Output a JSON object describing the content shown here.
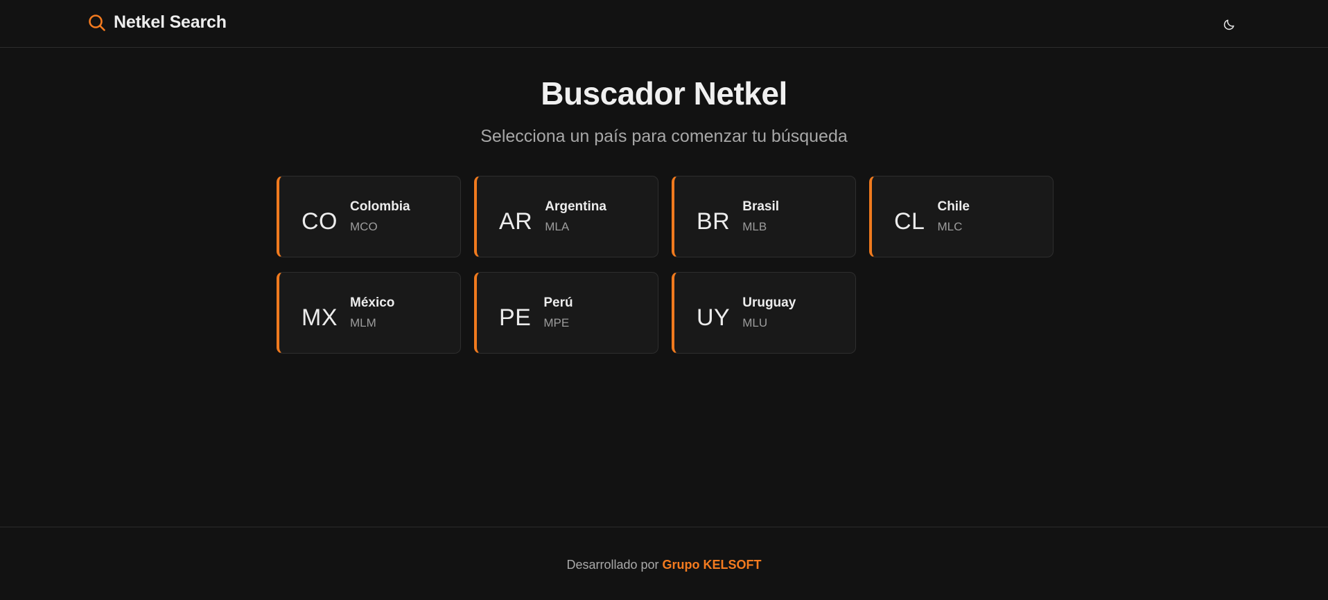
{
  "header": {
    "brand": "Netkel Search",
    "brand_icon": "search-icon",
    "theme_icon": "moon-icon"
  },
  "hero": {
    "title": "Buscador Netkel",
    "subtitle": "Selecciona un país para comenzar tu búsqueda"
  },
  "countries": [
    {
      "code": "CO",
      "name": "Colombia",
      "site": "MCO"
    },
    {
      "code": "AR",
      "name": "Argentina",
      "site": "MLA"
    },
    {
      "code": "BR",
      "name": "Brasil",
      "site": "MLB"
    },
    {
      "code": "CL",
      "name": "Chile",
      "site": "MLC"
    },
    {
      "code": "MX",
      "name": "México",
      "site": "MLM"
    },
    {
      "code": "PE",
      "name": "Perú",
      "site": "MPE"
    },
    {
      "code": "UY",
      "name": "Uruguay",
      "site": "MLU"
    }
  ],
  "footer": {
    "prefix": "Desarrollado por",
    "link": "Grupo KELSOFT"
  },
  "colors": {
    "accent": "#f07a1e",
    "background": "#121212",
    "card": "#191919"
  }
}
